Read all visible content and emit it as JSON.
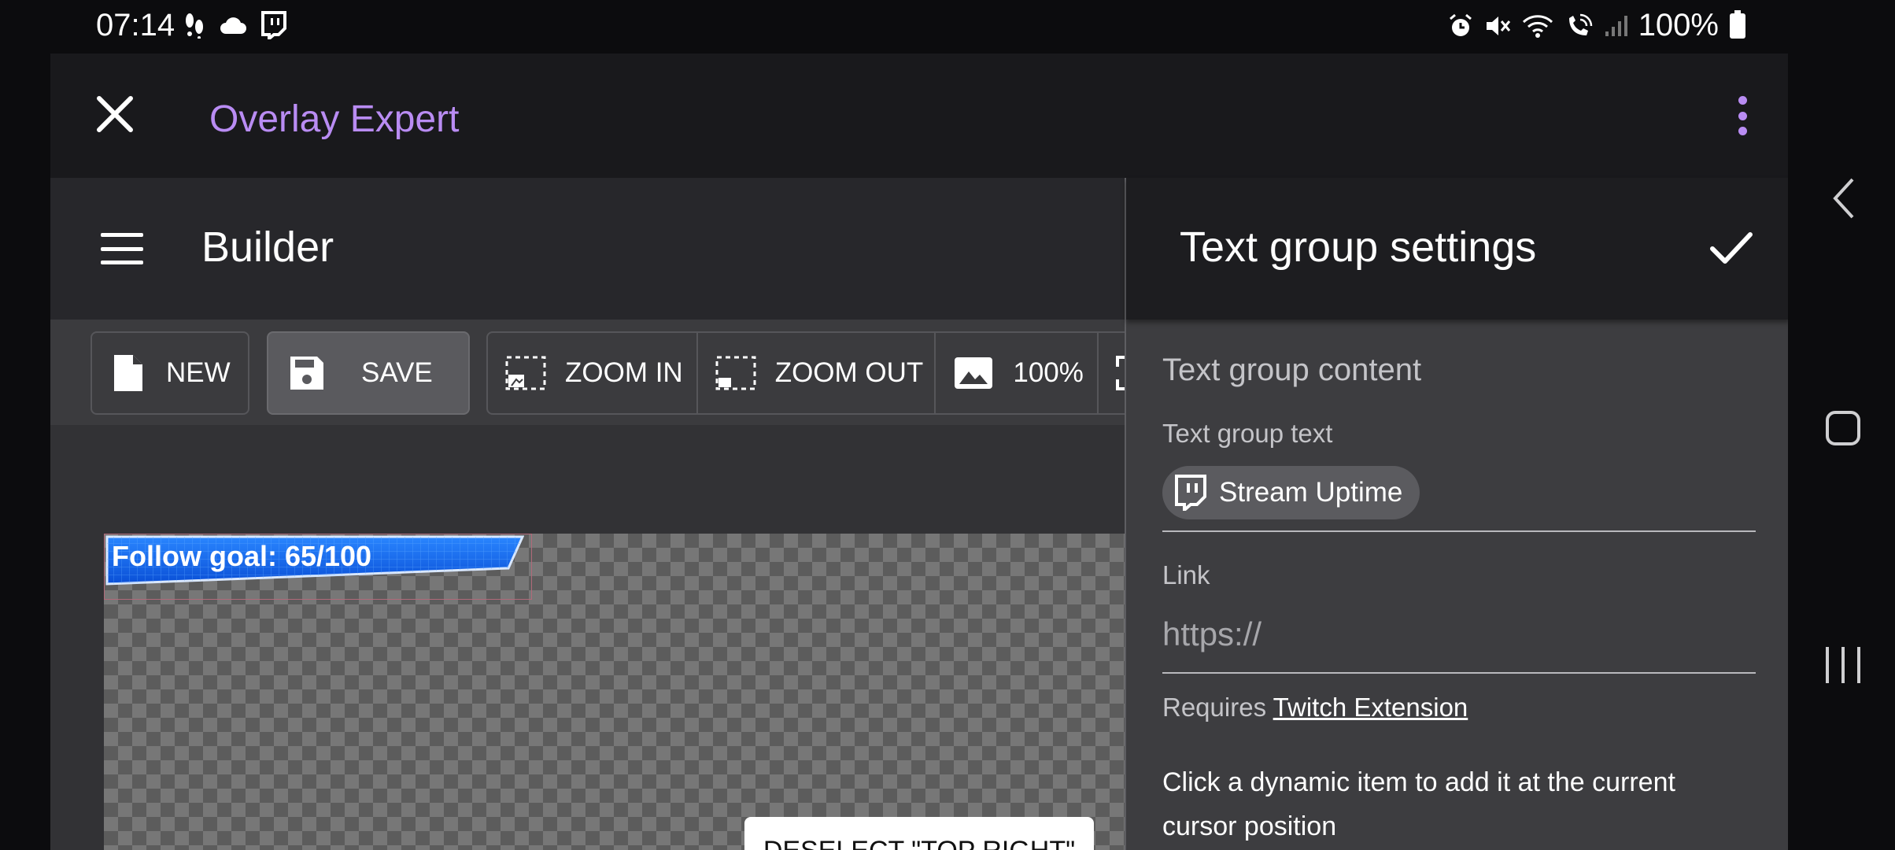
{
  "status_bar": {
    "time": "07:14",
    "battery": "100%",
    "left_icons": [
      "footsteps-icon",
      "cloud-icon",
      "twitch-icon"
    ],
    "right_icons": [
      "alarm-icon",
      "mute-icon",
      "wifi-icon",
      "wifi-call-icon",
      "signal-icon",
      "battery-icon"
    ]
  },
  "app": {
    "title": "Overlay Expert",
    "accent": "#b98cf3"
  },
  "builder": {
    "title": "Builder"
  },
  "toolbar": {
    "new_label": "NEW",
    "save_label": "SAVE",
    "zoom_in_label": "ZOOM IN",
    "zoom_out_label": "ZOOM OUT",
    "zoom_level": "100%"
  },
  "canvas": {
    "goal_text": "Follow goal: 65/100",
    "goal_progress": 0.65,
    "deselect_label": "DESELECT \"TOP RIGHT\""
  },
  "panel": {
    "title": "Text group settings",
    "section_title": "Text group content",
    "text_label": "Text group text",
    "chip_label": "Stream Uptime",
    "link_label": "Link",
    "link_placeholder": "https://",
    "requires_prefix": "Requires",
    "requires_link": "Twitch Extension",
    "hint": "Click a dynamic item to add it at the current cursor position"
  }
}
